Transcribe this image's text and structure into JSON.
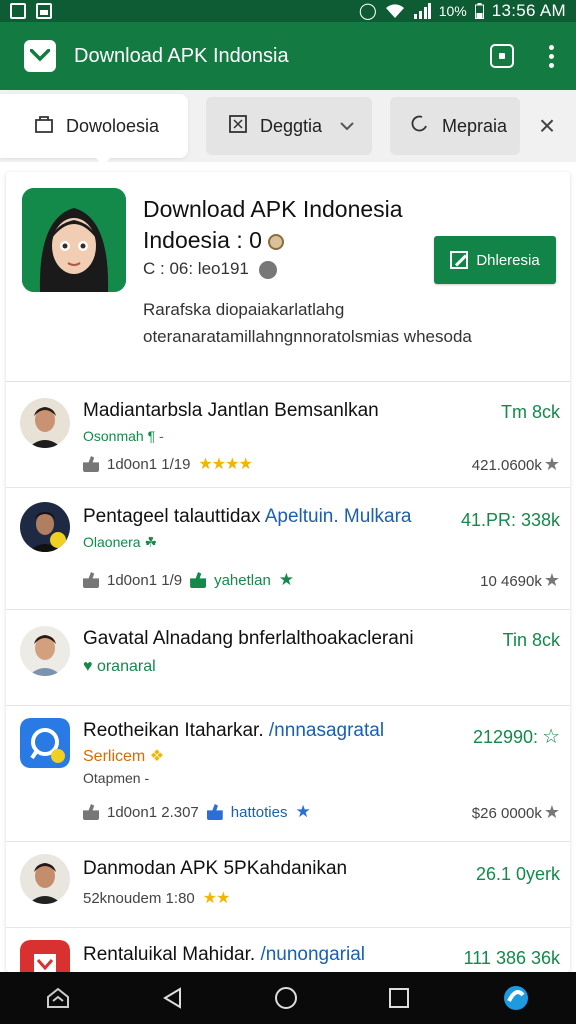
{
  "status": {
    "battery": "10%",
    "time": "13:56 AM"
  },
  "app_bar": {
    "title": "Download APK Indonsia"
  },
  "tabs": [
    {
      "label": "Dowoloesia"
    },
    {
      "label": "Deggtia"
    },
    {
      "label": "Mepraia"
    }
  ],
  "featured": {
    "title": "Download APK Indonesia",
    "subtitle": "Indoesia : 0",
    "meta": "C : 06: leo191",
    "button_label": "Dhleresia",
    "description": "Rarafska diopaiakarlatlahg oteranaratamillahngnnoratolsmias whesoda"
  },
  "rows": [
    {
      "title": "Madiantarbsla Jantlan Bemsanlkan",
      "sub": "Osonmah ¶ -",
      "meta": "1d0on1 1/19",
      "right": "Tm 8ck",
      "count": "421.0600k"
    },
    {
      "title": "Pentageel talauttidax",
      "title_hl": "Apeltuin. Mulkara",
      "sub": "Olaonera",
      "meta": "1d0on1 1/9",
      "tag": "yahetlan",
      "right": "41.PR: 338k",
      "count": "10 4690k"
    },
    {
      "title": "Gavatal Alnadang bnferlalthoakaclerani",
      "sub": "oranaral",
      "right": "Tin 8ck"
    },
    {
      "title": "Reotheikan Itaharkar.",
      "title_hl": "/nnnasagratal",
      "sub": "Serlicem",
      "sub2": "Otapmen -",
      "meta": "1d0on1 2.307",
      "tag": "hattoties",
      "right": "212990:",
      "count": "$26 0000k"
    },
    {
      "title": "Danmodan APK 5PKahdanikan",
      "sub": "52knoudem 1:80",
      "right": "26.1 0yerk"
    },
    {
      "title": "Rentaluikal Mahidar.",
      "title_hl": "/nunongarial",
      "right": "111 386 36k"
    }
  ]
}
